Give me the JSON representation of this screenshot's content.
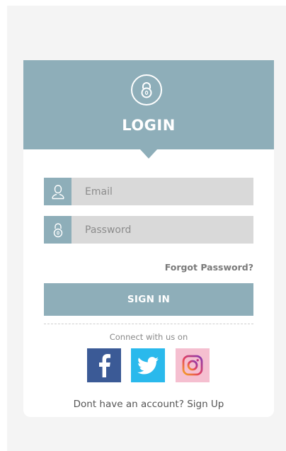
{
  "header": {
    "title": "LOGIN",
    "icon": "padlock-icon"
  },
  "form": {
    "email": {
      "placeholder": "Email",
      "value": "",
      "icon": "user-icon"
    },
    "password": {
      "placeholder": "Password",
      "value": "",
      "icon": "padlock-icon"
    },
    "forgot_label": "Forgot Password?",
    "signin_label": "SIGN IN"
  },
  "social": {
    "label": "Connect with us on",
    "networks": [
      "facebook",
      "twitter",
      "instagram"
    ]
  },
  "footer": {
    "prefix": "Dont have an account? ",
    "link": "Sign Up"
  },
  "colors": {
    "accent": "#8eaeb9",
    "field_bg": "#d9d9d9",
    "facebook": "#3b5a96",
    "twitter": "#2ab9ec",
    "instagram_bg": "#f5bfd0"
  }
}
